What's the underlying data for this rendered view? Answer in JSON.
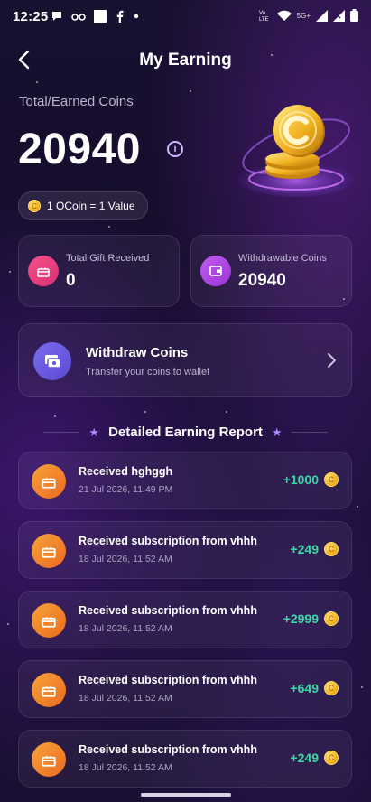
{
  "status": {
    "time": "12:25",
    "network": "5G+"
  },
  "header": {
    "title": "My Earning"
  },
  "summary": {
    "label": "Total/Earned Coins",
    "total": "20940",
    "info_symbol": "i",
    "rate": "1 OCoin = 1 Value",
    "coin_symbol": "C"
  },
  "stats": [
    {
      "label": "Total Gift Received",
      "value": "0",
      "icon": "gift-icon",
      "color": "#ec3f8f"
    },
    {
      "label": "Withdrawable Coins",
      "value": "20940",
      "icon": "wallet-icon",
      "color": "#b046e6"
    }
  ],
  "withdraw": {
    "title": "Withdraw Coins",
    "subtitle": "Transfer your coins to wallet"
  },
  "report": {
    "title": "Detailed Earning Report",
    "rows": [
      {
        "title": "Received hghggh",
        "time": "21 Jul 2026, 11:49 PM",
        "amount": "+1000"
      },
      {
        "title": "Received subscription from vhhh",
        "time": "18 Jul 2026, 11:52 AM",
        "amount": "+249"
      },
      {
        "title": "Received subscription from vhhh",
        "time": "18 Jul 2026, 11:52 AM",
        "amount": "+2999"
      },
      {
        "title": "Received subscription from vhhh",
        "time": "18 Jul 2026, 11:52 AM",
        "amount": "+649"
      },
      {
        "title": "Received subscription from vhhh",
        "time": "18 Jul 2026, 11:52 AM",
        "amount": "+249"
      }
    ]
  },
  "colors": {
    "accent": "#7b6bf0",
    "positive": "#3ed6a5",
    "coin": "#f0b320"
  }
}
